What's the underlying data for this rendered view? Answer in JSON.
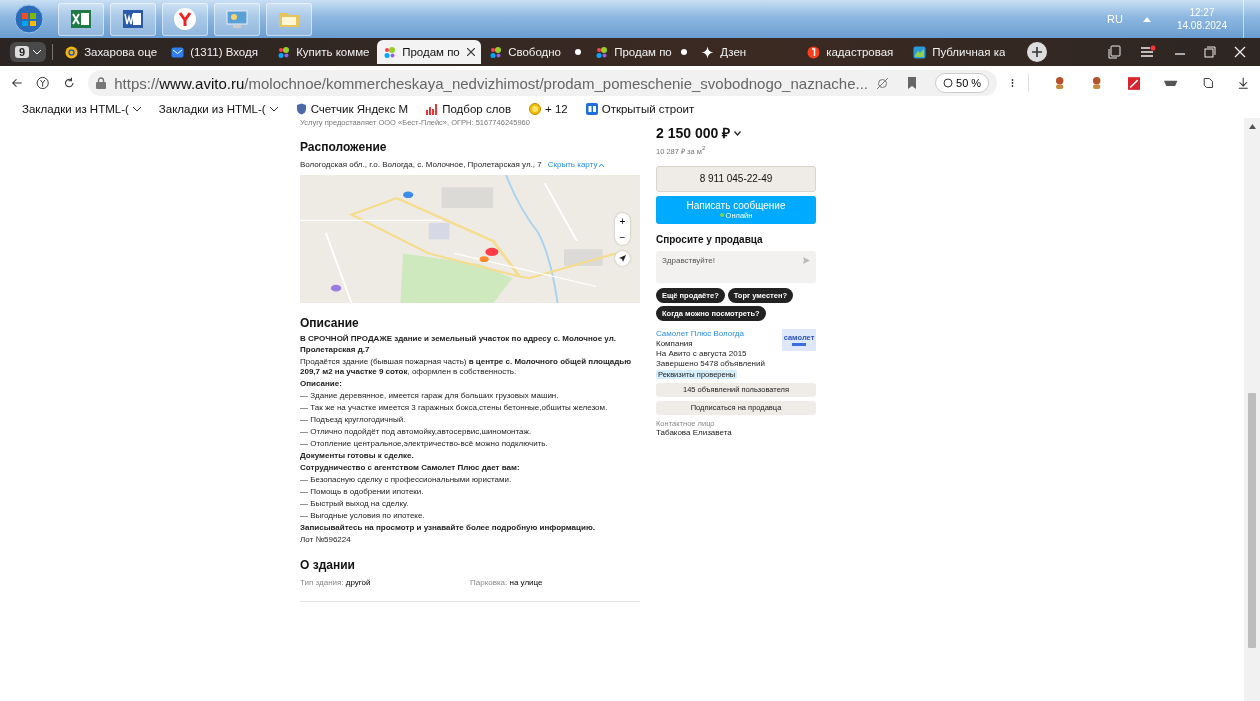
{
  "taskbar": {
    "apps": [
      {
        "kind": "start"
      },
      {
        "kind": "excel"
      },
      {
        "kind": "word"
      },
      {
        "kind": "yandex"
      },
      {
        "kind": "control"
      },
      {
        "kind": "folder"
      }
    ],
    "language": "RU",
    "time": "12:27",
    "date": "14.08.2024"
  },
  "browser": {
    "tab_count": "9",
    "tabs": [
      {
        "title": "Захарова оце",
        "kind": "mail",
        "selected": false,
        "dot": false
      },
      {
        "title": "(1311) Входя",
        "kind": "inbox",
        "selected": false,
        "dot": false
      },
      {
        "title": "Купить комме",
        "kind": "avito",
        "selected": false,
        "dot": false
      },
      {
        "title": "Продам по",
        "kind": "avito",
        "selected": true,
        "dot": false
      },
      {
        "title": "Свободно",
        "kind": "avito",
        "selected": false,
        "dot": true
      },
      {
        "title": "Продам по",
        "kind": "avito",
        "selected": false,
        "dot": true
      },
      {
        "title": "Дзен",
        "kind": "zen",
        "selected": false,
        "dot": false
      },
      {
        "title": "кадастровая",
        "kind": "yandex",
        "selected": false,
        "dot": false
      },
      {
        "title": "Публичная ка",
        "kind": "map",
        "selected": false,
        "dot": false
      }
    ],
    "address": {
      "scheme": "https://",
      "domain": "www.avito.ru",
      "path": "/molochnoe/kommercheskaya_nedvizhimost/prodam_pomeschenie_svobodnogo_naznache..."
    },
    "zoom": "50 %",
    "bookmarks": [
      {
        "label": "Закладки из HTML-(",
        "kind": "folder",
        "menu": true
      },
      {
        "label": "Закладки из HTML-(",
        "kind": "folder",
        "menu": true
      },
      {
        "label": "Счетчик Яндекс М",
        "kind": "shield",
        "menu": false
      },
      {
        "label": "Подбор слов",
        "kind": "bars",
        "menu": false
      },
      {
        "label": "+ 12",
        "kind": "coin",
        "menu": false
      },
      {
        "label": "Открытый строит",
        "kind": "rc",
        "menu": false
      }
    ]
  },
  "listing": {
    "provider_note": "Услугу предоставляет ООО «Бест-Плейс», ОГРН: 5167746245960",
    "location": {
      "heading": "Расположение",
      "address": "Вологодская обл., г.о. Вологда, с. Молочное, Пролетарская ул., 7",
      "map_link": "Скрыть карту",
      "zoom_in": "+",
      "zoom_out": "−"
    },
    "description": {
      "heading": "Описание",
      "paragraphs": [
        {
          "text": "В СРОЧНОЙ ПРОДАЖЕ здание и земельный участок по адресу с. Молочное ул. Пролетарская д.7",
          "bold": true
        },
        {
          "text": "Продаётся здание (бывшая пожарная часть) **в центре с. Молочного общей площадью 209,7 м2 на участке 9 соток**, оформлен в собственность.",
          "bold": false
        },
        {
          "text": "Описание:",
          "bold": true
        },
        {
          "text": "— Здание деревянное, имеется гараж для больших грузовых машин.",
          "bold": false
        },
        {
          "text": "— Так же на участке имеется 3 гаражных бокса,стены бетонные,обшиты железом.",
          "bold": false
        },
        {
          "text": "— Подъезд круглогодичный.",
          "bold": false
        },
        {
          "text": "— Отлично подойдёт под автомойку,автосервис,шиномонтаж.",
          "bold": false
        },
        {
          "text": "— Отопление центральное,электричество-всё можно подключить.",
          "bold": false
        },
        {
          "text": "Документы готовы к сделке.",
          "bold": true
        },
        {
          "text": "Сотрудничество с агентством Самолет Плюс дает вам:",
          "bold": true
        },
        {
          "text": "— Безопасную сделку с профессиональными юристами.",
          "bold": false
        },
        {
          "text": "— Помощь в одобрении ипотеки.",
          "bold": false
        },
        {
          "text": "— Быстрый выход на сделку.",
          "bold": false
        },
        {
          "text": "— Выгодные условия по ипотеке.",
          "bold": false
        },
        {
          "text": "Записывайтесь на просмотр и узнавайте более подробную информацию.",
          "bold": true
        },
        {
          "text": "Лот №596224",
          "bold": false
        }
      ]
    },
    "building": {
      "heading": "О здании",
      "fields": [
        {
          "label": "Тип здания:",
          "value": "другой"
        },
        {
          "label": "Парковка:",
          "value": "на улице"
        }
      ]
    },
    "price": "2 150 000 ₽",
    "price_per_m2": "10 287 ₽ за м$^{2}$",
    "phone": "8 911 045-22-49",
    "message_button": "Написать сообщение",
    "online": "Онлайн",
    "ask": {
      "heading": "Спросите у продавца",
      "placeholder": "Здравствуйте!",
      "chips": [
        "Ещё продаёте?",
        "Торг уместен?",
        "Когда можно посмотреть?"
      ]
    },
    "seller": {
      "name": "Самолет Плюс Вологда",
      "type": "Компания",
      "since": "На Авито с августа 2015",
      "completed": "Завершено 5478 объявлений",
      "badge": "Реквизиты проверены",
      "logo_text": "самолет",
      "ads_button": "145 объявлений пользователя",
      "subscribe_button": "Подписаться на продавца",
      "contact_label": "Контактное лицо",
      "contact_name": "Табакова Елизавета"
    }
  }
}
